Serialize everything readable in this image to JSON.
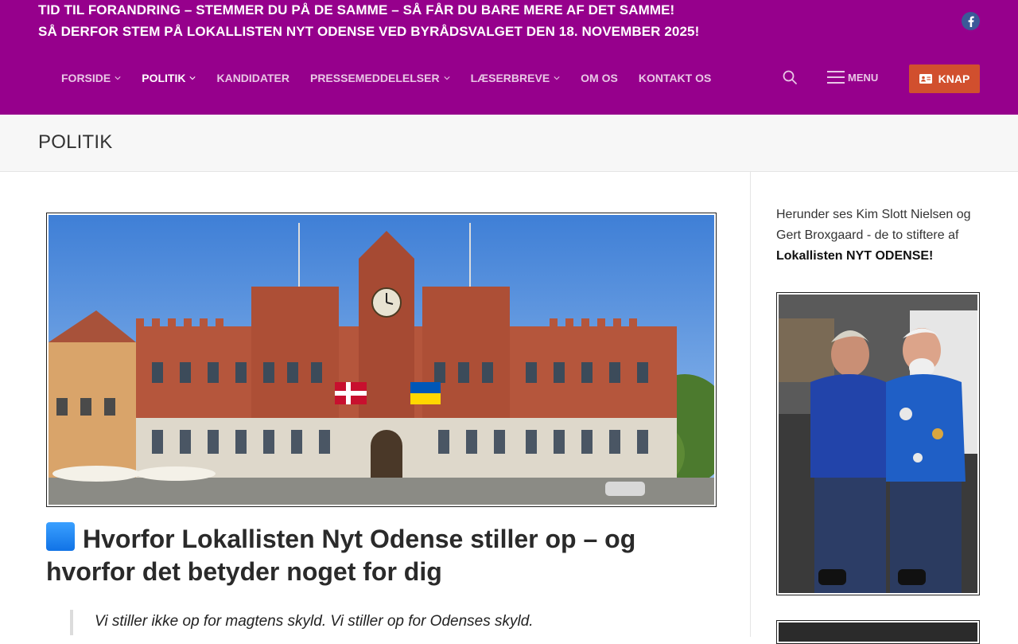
{
  "header": {
    "headline_1": "TID TIL FORANDRING – STEMMER DU PÅ DE SAMME – SÅ FÅR DU BARE MERE AF DET SAMME!",
    "headline_2": "SÅ DERFOR STEM PÅ LOKALLISTEN NYT ODENSE VED BYRÅDSVALGET DEN 18. NOVEMBER 2025!",
    "colors": {
      "background": "#96008c",
      "button": "#d14f2e",
      "facebook": "#3b5998"
    }
  },
  "nav": {
    "items": [
      {
        "label": "FORSIDE",
        "dropdown": true
      },
      {
        "label": "POLITIK",
        "dropdown": true,
        "active": true
      },
      {
        "label": "KANDIDATER",
        "dropdown": false
      },
      {
        "label": "PRESSEMEDDELELSER",
        "dropdown": true
      },
      {
        "label": "LÆSERBREVE",
        "dropdown": true
      },
      {
        "label": "OM OS",
        "dropdown": false
      },
      {
        "label": "KONTAKT OS",
        "dropdown": false
      }
    ],
    "menu_label": "MENU",
    "button_label": "KNAP",
    "icons": [
      "facebook-icon",
      "search-icon",
      "hamburger-icon",
      "id-card-icon"
    ]
  },
  "page": {
    "title": "POLITIK"
  },
  "post": {
    "title": "Hvorfor Lokallisten Nyt Odense stiller op – og hvorfor det betyder noget for dig",
    "quote": "Vi stiller ikke op for magtens skyld. Vi stiller op for Odenses skyld."
  },
  "sidebar": {
    "text": "Herunder ses Kim Slott Nielsen og Gert Broxgaard - de to stiftere af",
    "text_bold": "Lokallisten NYT ODENSE!"
  }
}
